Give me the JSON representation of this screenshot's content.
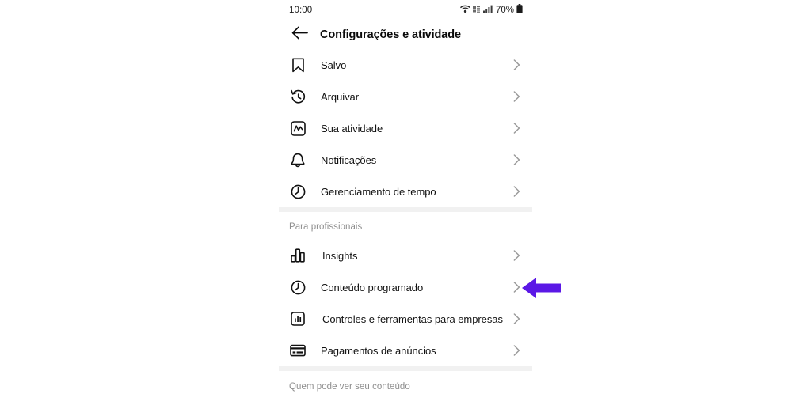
{
  "statusbar": {
    "time": "10:00",
    "battery_text": "70%",
    "icons": [
      "wifi-icon",
      "data-speed-icon",
      "signal-bars-icon",
      "battery-icon"
    ]
  },
  "header": {
    "back_icon": "arrow-left-icon",
    "title": "Configurações e atividade"
  },
  "sections": [
    {
      "title": null,
      "items": [
        {
          "icon": "bookmark-icon",
          "label": "Salvo",
          "chevron": "chevron-right-icon",
          "indent": false
        },
        {
          "icon": "archive-clock-icon",
          "label": "Arquivar",
          "chevron": "chevron-right-icon",
          "indent": false
        },
        {
          "icon": "activity-chart-icon",
          "label": "Sua atividade",
          "chevron": "chevron-right-icon",
          "indent": false
        },
        {
          "icon": "bell-icon",
          "label": "Notificações",
          "chevron": "chevron-right-icon",
          "indent": false
        },
        {
          "icon": "clock-icon",
          "label": "Gerenciamento de tempo",
          "chevron": "chevron-right-icon",
          "indent": false
        }
      ]
    },
    {
      "title": "Para profissionais",
      "items": [
        {
          "icon": "bar-chart-icon",
          "label": "Insights",
          "chevron": "chevron-right-icon",
          "indent": true
        },
        {
          "icon": "clock-icon",
          "label": "Conteúdo programado",
          "chevron": "chevron-right-icon",
          "indent": false
        },
        {
          "icon": "business-tools-icon",
          "label": "Controles e ferramentas para empresas",
          "chevron": "chevron-right-icon",
          "indent": true
        },
        {
          "icon": "credit-card-icon",
          "label": "Pagamentos de anúncios",
          "chevron": "chevron-right-icon",
          "indent": false
        }
      ]
    },
    {
      "title": "Quem pode ver seu conteúdo",
      "items": []
    }
  ],
  "annotation": {
    "name": "purple-arrow-pointer",
    "direction": "left",
    "color": "#5B18E6",
    "points_at": "Conteúdo programado"
  },
  "colors": {
    "accent": "#5B18E6",
    "text": "#111111",
    "muted": "#8e8e8e",
    "divider": "#f1f1f1",
    "background": "#ffffff"
  }
}
